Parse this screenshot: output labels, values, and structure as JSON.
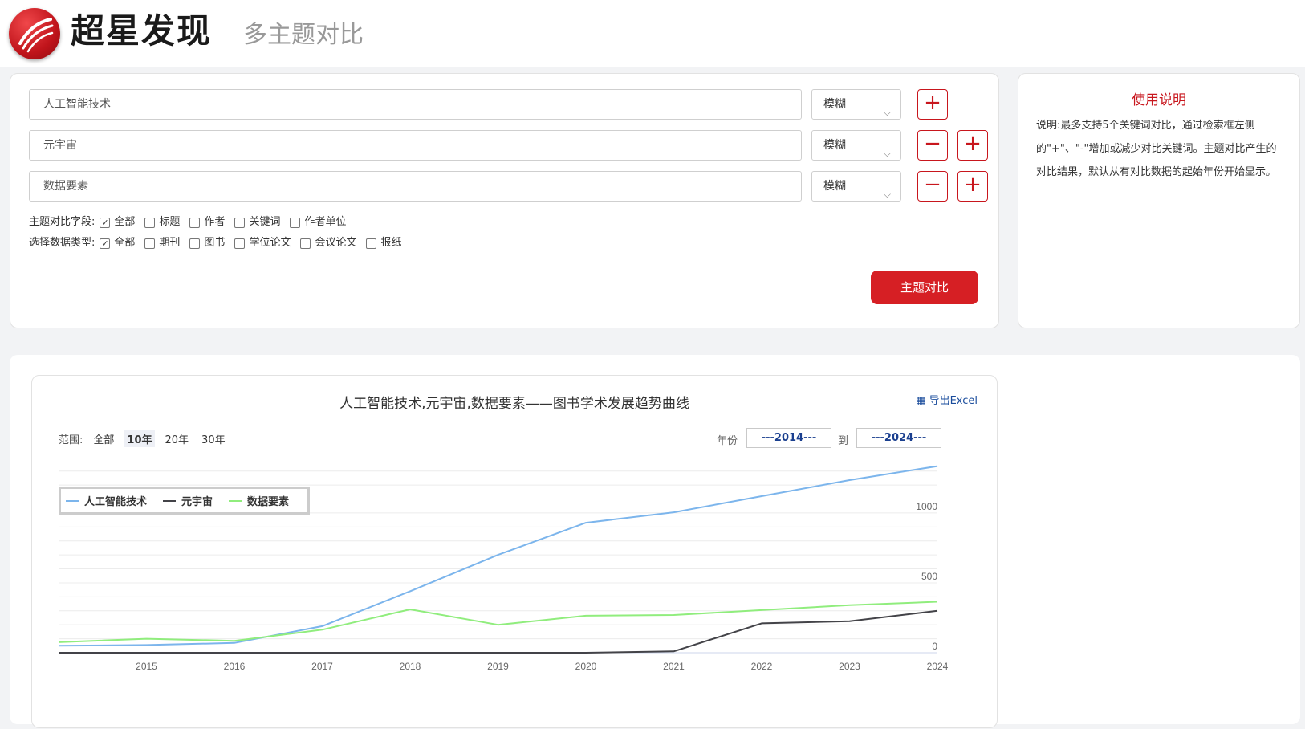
{
  "header": {
    "brand": "超星发现",
    "subtitle": "多主题对比"
  },
  "search": {
    "rows": [
      {
        "keyword": "人工智能技术",
        "match": "模糊"
      },
      {
        "keyword": "元宇宙",
        "match": "模糊"
      },
      {
        "keyword": "数据要素",
        "match": "模糊"
      }
    ],
    "fields": {
      "label": "主题对比字段:",
      "options": [
        {
          "label": "全部",
          "checked": true
        },
        {
          "label": "标题",
          "checked": false
        },
        {
          "label": "作者",
          "checked": false
        },
        {
          "label": "关键词",
          "checked": false
        },
        {
          "label": "作者单位",
          "checked": false
        }
      ]
    },
    "types": {
      "label": "选择数据类型:",
      "options": [
        {
          "label": "全部",
          "checked": true
        },
        {
          "label": "期刊",
          "checked": false
        },
        {
          "label": "图书",
          "checked": false
        },
        {
          "label": "学位论文",
          "checked": false
        },
        {
          "label": "会议论文",
          "checked": false
        },
        {
          "label": "报纸",
          "checked": false
        }
      ]
    },
    "compare_label": "主题对比",
    "plus": "+",
    "minus": "−"
  },
  "help": {
    "title": "使用说明",
    "text": "说明:最多支持5个关键词对比，通过检索框左侧的\"+\"、\"-\"增加或减少对比关键词。主题对比产生的对比结果，默认从有对比数据的起始年份开始显示。"
  },
  "chart_section": {
    "export_label": "导出Excel",
    "range_label": "范围:",
    "ranges": [
      "全部",
      "10年",
      "20年",
      "30年"
    ],
    "selected_range": "10年",
    "year_label": "年份",
    "to_label": "到",
    "year_from": "---2014---",
    "year_to": "---2024---"
  },
  "chart_data": {
    "type": "line",
    "title": "人工智能技术,元宇宙,数据要素——图书学术发展趋势曲线",
    "x": [
      2014,
      2015,
      2016,
      2017,
      2018,
      2019,
      2020,
      2021,
      2022,
      2023,
      2024
    ],
    "x_ticks": [
      2015,
      2016,
      2017,
      2018,
      2019,
      2020,
      2021,
      2022,
      2023,
      2024
    ],
    "y_ticks": [
      0,
      500,
      1000
    ],
    "ylim": [
      0,
      1350
    ],
    "series": [
      {
        "name": "人工智能技术",
        "color": "#7cb5ec",
        "values": [
          50,
          55,
          70,
          190,
          440,
          700,
          930,
          1005,
          1120,
          1235,
          1335
        ]
      },
      {
        "name": "元宇宙",
        "color": "#434348",
        "values": [
          0,
          0,
          0,
          0,
          0,
          0,
          0,
          10,
          210,
          225,
          300
        ]
      },
      {
        "name": "数据要素",
        "color": "#90ed7d",
        "values": [
          75,
          100,
          85,
          165,
          310,
          200,
          265,
          270,
          305,
          340,
          365
        ]
      }
    ],
    "legend": "top-left",
    "grid": true
  }
}
